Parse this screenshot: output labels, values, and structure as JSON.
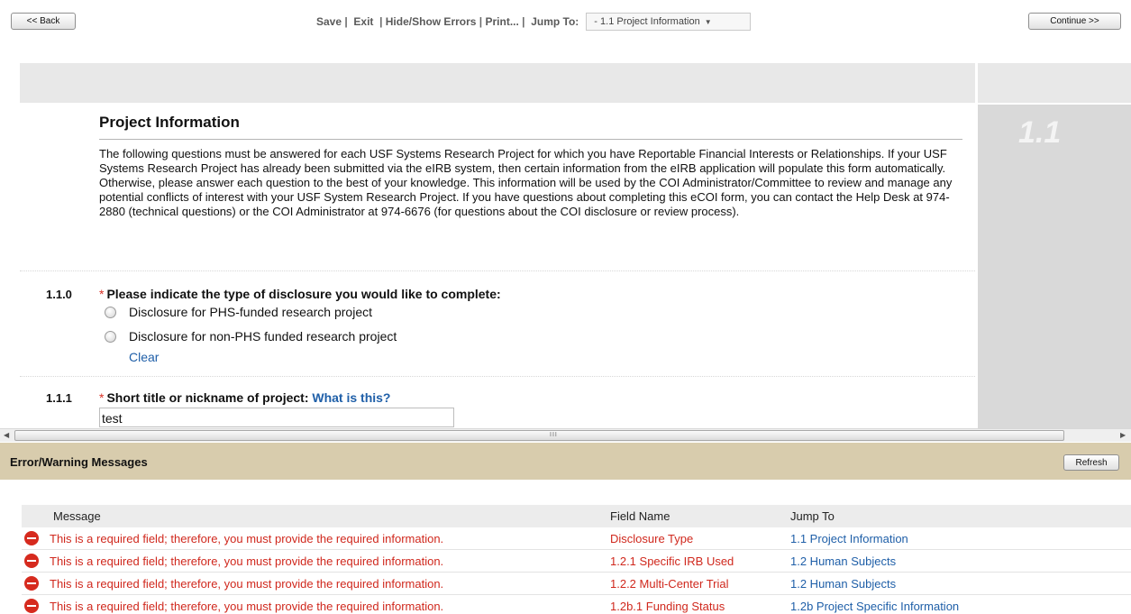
{
  "toolbar": {
    "back_label": "<< Back",
    "save_label": "Save",
    "exit_label": "Exit",
    "hide_show_label": "Hide/Show Errors",
    "print_label": "Print...",
    "jump_to_label": "Jump To:",
    "jump_select_value": "- 1.1 Project Information",
    "continue_label": "Continue >>"
  },
  "section": {
    "number": "1.1",
    "title": "Project Information",
    "intro": "The following questions must be answered for each USF Systems Research Project for which you have Reportable Financial Interests or Relationships. If your USF Systems Research Project has already been submitted via the eIRB system, then certain information from the eIRB application will populate this form automatically. Otherwise, please answer each question to the best of your knowledge. This information will be used by the COI Administrator/Committee to review and manage any potential conflicts of interest with your USF System Research Project. If you have questions about completing this eCOI form, you can contact the Help Desk at 974-2880 (technical questions) or the COI Administrator at 974-6676 (for questions about the COI disclosure or review process)."
  },
  "questions": {
    "q0": {
      "number": "1.1.0",
      "required_mark": "*",
      "label": "Please indicate the type of disclosure you would like to complete:",
      "options": [
        "Disclosure for PHS-funded research project",
        "Disclosure for non-PHS funded research project"
      ],
      "clear_label": "Clear"
    },
    "q1": {
      "number": "1.1.1",
      "required_mark": "*",
      "label": "Short title or nickname of project:",
      "help_link": "What is this?",
      "value": "test"
    }
  },
  "scrollbar": {
    "grip": "III"
  },
  "errors": {
    "title": "Error/Warning Messages",
    "refresh_label": "Refresh",
    "columns": [
      "Message",
      "Field Name",
      "Jump To"
    ],
    "rows": [
      {
        "message": "This is a required field; therefore, you must provide the required information.",
        "field": "Disclosure Type",
        "jump": "1.1 Project Information"
      },
      {
        "message": "This is a required field; therefore, you must provide the required information.",
        "field": "1.2.1 Specific IRB Used",
        "jump": "1.2 Human Subjects"
      },
      {
        "message": "This is a required field; therefore, you must provide the required information.",
        "field": "1.2.2 Multi-Center Trial",
        "jump": "1.2 Human Subjects"
      },
      {
        "message": "This is a required field; therefore, you must provide the required information.",
        "field": "1.2b.1 Funding Status",
        "jump": "1.2b Project Specific Information"
      }
    ]
  }
}
